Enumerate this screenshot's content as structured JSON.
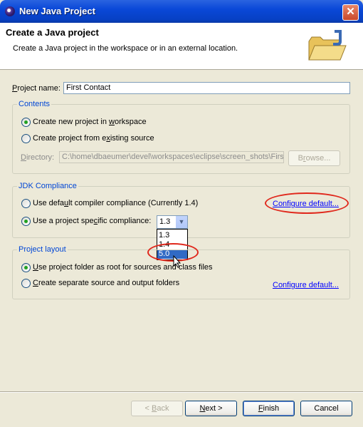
{
  "window": {
    "title": "New Java Project",
    "close_glyph": "✕"
  },
  "header": {
    "title": "Create a Java project",
    "description": "Create a Java project in the workspace or in an external location.",
    "icon": "java-folder-icon"
  },
  "project_name": {
    "label_u": "P",
    "label_rest": "roject name:",
    "value": "First Contact"
  },
  "contents": {
    "legend": "Contents",
    "new_in_workspace": {
      "a": "Create new project in ",
      "u": "w",
      "b": "orkspace",
      "checked": true
    },
    "from_existing": {
      "a": "Create project from e",
      "u": "x",
      "b": "isting source",
      "checked": false
    },
    "directory": {
      "u": "D",
      "rest": "irectory:",
      "value": "C:\\home\\dbaeumer\\devel\\workspaces\\eclipse\\screen_shots\\First"
    },
    "browse": {
      "u": "r",
      "a": "B",
      "b": "owse..."
    }
  },
  "jdk": {
    "legend": "JDK Compliance",
    "default_opt": {
      "a": "Use defa",
      "u": "u",
      "b": "lt compiler compliance (Currently 1.4)",
      "checked": false
    },
    "specific_opt": {
      "a": "Use a project spe",
      "u": "c",
      "b": "ific compliance:",
      "checked": true
    },
    "configure": "Configure default...",
    "combo_value": "1.3",
    "dropdown": [
      "1.3",
      "1.4",
      "5.0"
    ],
    "dropdown_selected": "5.0"
  },
  "layout": {
    "legend": "Project layout",
    "root_opt": {
      "a": "",
      "u": "U",
      "b": "se project folder as root for sources and class files",
      "checked": true
    },
    "separate_opt": {
      "a": "",
      "u": "C",
      "b": "reate separate source and output folders",
      "checked": false
    },
    "configure": "Configure default..."
  },
  "buttons": {
    "back": {
      "a": "< ",
      "u": "B",
      "b": "ack",
      "enabled": false
    },
    "next": {
      "a": "",
      "u": "N",
      "b": "ext >"
    },
    "finish": {
      "a": "",
      "u": "F",
      "b": "inish"
    },
    "cancel": "Cancel"
  },
  "colors": {
    "titlebar": "#0a48d8",
    "highlight_oval": "#e0281c",
    "selection": "#316ac5",
    "link": "#0000ff"
  }
}
